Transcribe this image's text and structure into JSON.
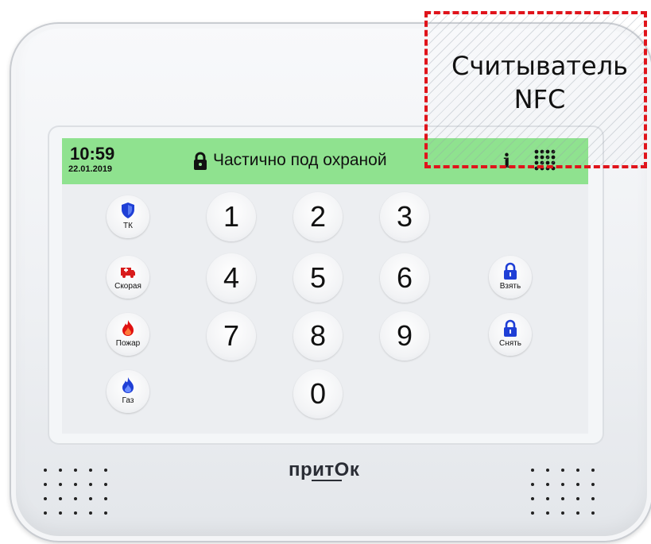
{
  "status_bar": {
    "time": "10:59",
    "date": "22.01.2019",
    "status": "Частично под охраной",
    "color": "#8fe28f"
  },
  "keypad": {
    "digits": [
      "1",
      "2",
      "3",
      "4",
      "5",
      "6",
      "7",
      "8",
      "9",
      "0"
    ]
  },
  "left_buttons": [
    {
      "label": "ТК",
      "icon": "shield-icon",
      "color": "#1f3fd6"
    },
    {
      "label": "Скорая",
      "icon": "ambulance-icon",
      "color": "#d81b1b"
    },
    {
      "label": "Пожар",
      "icon": "fire-icon",
      "color": "#e01010"
    },
    {
      "label": "Газ",
      "icon": "gas-flame-icon",
      "color": "#1f3fd6"
    }
  ],
  "right_buttons": [
    {
      "label": "Взять",
      "icon": "lock-icon",
      "color": "#1f3fd6"
    },
    {
      "label": "Снять",
      "icon": "unlock-icon",
      "color": "#1f3fd6"
    }
  ],
  "logo": "притOк",
  "nfc_annotation": {
    "line1": "Считыватель",
    "line2": "NFC",
    "border_color": "#e0141b"
  }
}
